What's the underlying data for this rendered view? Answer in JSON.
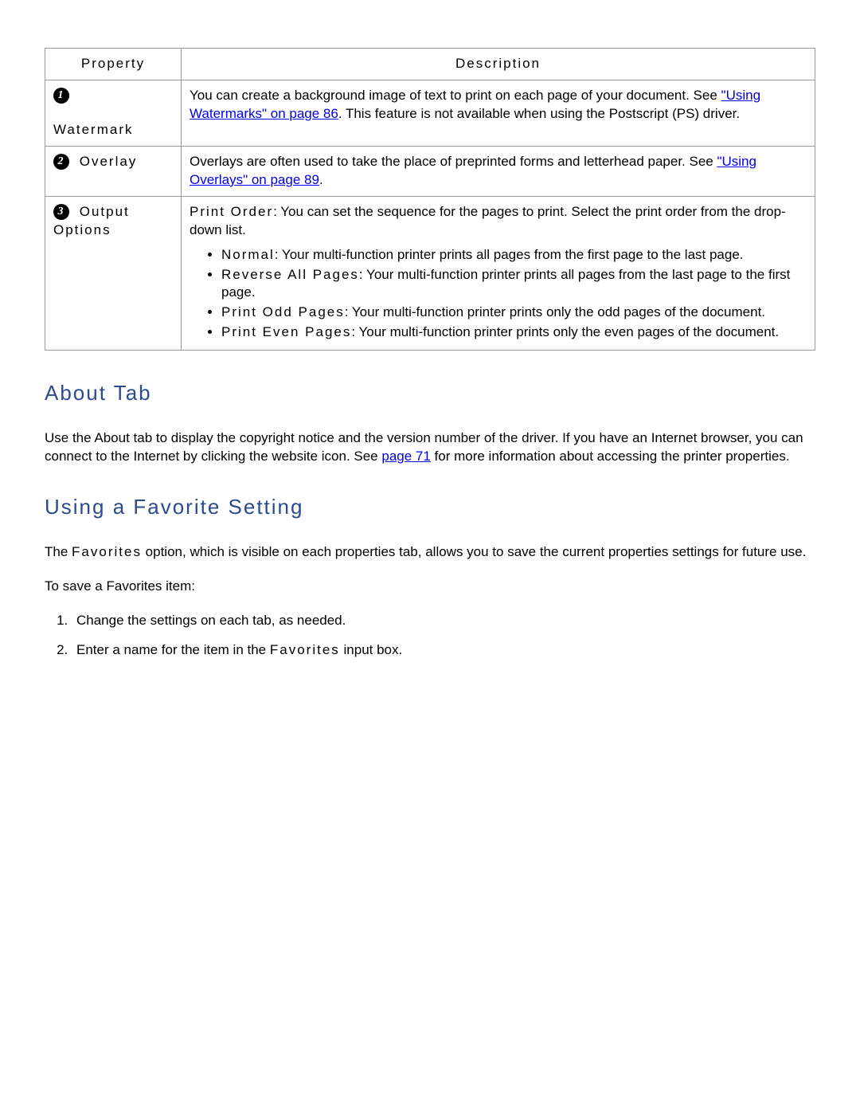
{
  "table": {
    "headers": {
      "property": "Property",
      "description": "Description"
    },
    "rows": [
      {
        "num": "1",
        "label": "Watermark",
        "desc_before": "You can create a background image of text to print on each page of your document. See ",
        "link": "\"Using Watermarks\" on page 86",
        "desc_after": ". This feature is not available when using the Postscript (PS) driver."
      },
      {
        "num": "2",
        "label": "Overlay",
        "desc_before": "Overlays are often used to take the place of preprinted forms and letterhead paper. See ",
        "link": "\"Using Overlays\" on page 89",
        "desc_after": "."
      },
      {
        "num": "3",
        "label": "Output Options",
        "intro_bold": "Print Order",
        "intro_rest": ": You can set the sequence for the pages to print. Select the print order from the drop-down list.",
        "bullets": [
          {
            "b": "Normal",
            "t": ": Your multi-function printer prints all pages from the first page to the last page."
          },
          {
            "b": "Reverse All Pages",
            "t": ": Your multi-function printer prints all pages from the last page to the first page."
          },
          {
            "b": "Print Odd Pages",
            "t": ": Your multi-function printer prints only the odd pages of the document."
          },
          {
            "b": "Print Even Pages",
            "t": ": Your multi-function printer prints only the even pages of the document."
          }
        ]
      }
    ]
  },
  "about": {
    "heading": "About Tab",
    "p_before": "Use the About tab to display the copyright notice and the version number of the driver. If you have an Internet browser, you can connect to the Internet by clicking the website icon. See ",
    "link": "page 71",
    "p_after": " for more information about accessing the printer properties."
  },
  "favorite": {
    "heading": "Using a Favorite Setting",
    "p1_a": "The ",
    "p1_bold": "Favorites",
    "p1_b": " option, which is visible on each properties tab, allows you to save the current properties settings for future use.",
    "p2": "To save a Favorites item:",
    "steps": [
      "Change the settings on each tab, as needed.",
      {
        "a": "Enter a name for the item in the ",
        "b": "Favorites",
        "c": " input box."
      }
    ]
  }
}
